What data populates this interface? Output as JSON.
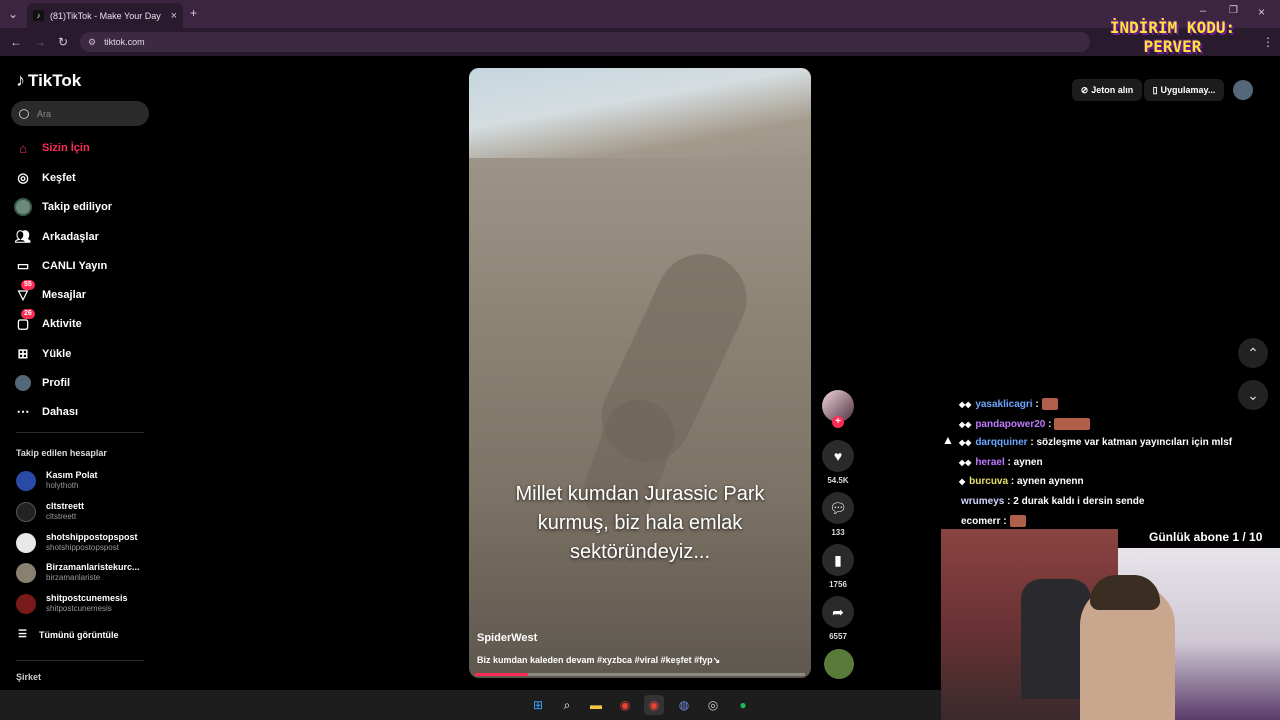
{
  "browser": {
    "tab_title": "(81)TikTok - Make Your Day",
    "url": "tiktok.com",
    "promo_line1": "İNDİRİM KODU:",
    "promo_line2": "PERVER"
  },
  "sidebar": {
    "logo": "TikTok",
    "search_placeholder": "Ara",
    "nav": [
      {
        "label": "Sizin İçin",
        "icon": "home-icon"
      },
      {
        "label": "Keşfet",
        "icon": "compass-icon"
      },
      {
        "label": "Takip ediliyor",
        "icon": "following-avatar-icon"
      },
      {
        "label": "Arkadaşlar",
        "icon": "friends-icon"
      },
      {
        "label": "CANLI Yayın",
        "icon": "live-icon"
      },
      {
        "label": "Mesajlar",
        "icon": "messages-icon",
        "badge": "55"
      },
      {
        "label": "Aktivite",
        "icon": "activity-icon",
        "badge": "26"
      },
      {
        "label": "Yükle",
        "icon": "upload-icon"
      },
      {
        "label": "Profil",
        "icon": "profile-icon"
      },
      {
        "label": "Dahası",
        "icon": "more-icon"
      }
    ],
    "followed_heading": "Takip edilen hesaplar",
    "followed": [
      {
        "name": "Kasım Polat",
        "handle": "holythoth"
      },
      {
        "name": "cltstreett",
        "handle": "cltstreett"
      },
      {
        "name": "shotshippostopspost",
        "handle": "shotshippostopspost"
      },
      {
        "name": "Birzamanlaristekurc...",
        "handle": "birzamanlariste"
      },
      {
        "name": "shitpostcunemesis",
        "handle": "shitpostcunemesis"
      }
    ],
    "see_all": "Tümünü görüntüle",
    "company": "Şirket"
  },
  "video": {
    "caption": "Millet kumdan Jurassic Park kurmuş, biz hala emlak sektöründeyiz...",
    "author": "SpiderWest",
    "description": "Biz kumdan kaleden devam #xyzbca #viral #keşfet #fyp↘",
    "progress": 0.16
  },
  "actions": {
    "likes": "54.5K",
    "comments": "133",
    "saves": "1756",
    "shares": "6557"
  },
  "topbar": {
    "coins": "Jeton alın",
    "app": "Uygulamay..."
  },
  "chat": [
    {
      "user": "yasaklicagri",
      "msg": "",
      "emote": true,
      "user_color": "#6aa8ff"
    },
    {
      "user": "pandapower20",
      "msg": "",
      "emote": true,
      "wide": true,
      "user_color": "#c17aff"
    },
    {
      "user": "darqquiner",
      "msg": "sözleşme var katman yayıncıları için mlsf",
      "user_color": "#6aa8ff"
    },
    {
      "user": "herael",
      "msg": "aynen",
      "user_color": "#c17aff"
    },
    {
      "user": "burcuva",
      "msg": "aynen aynenn",
      "user_color": "#e6e06a"
    },
    {
      "user": "wrumeys",
      "msg": "2 durak kaldı i dersin sende",
      "user_color": "#cfd6ff"
    },
    {
      "user": "ecomerr",
      "msg": "",
      "emote": true,
      "user_color": "#ffffff"
    }
  ],
  "overlay": {
    "subs_goal": "Günlük abone 1 / 10"
  },
  "colors": {
    "accent": "#fe2c55",
    "tabbar": "#3b2540"
  }
}
